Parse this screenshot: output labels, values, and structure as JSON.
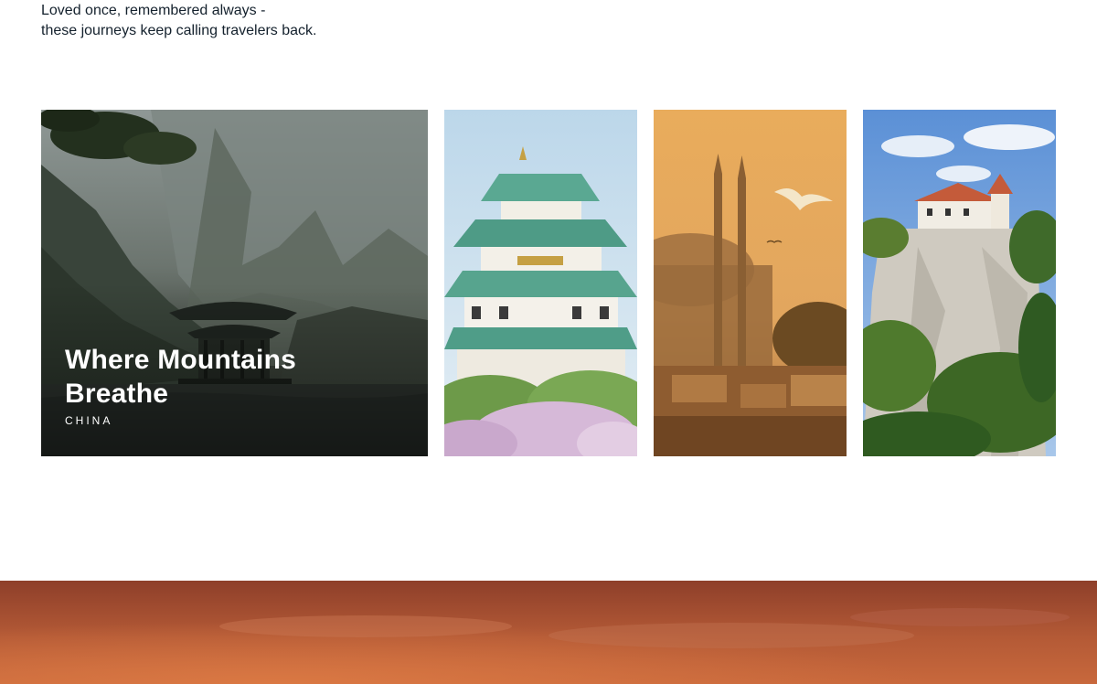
{
  "intro": {
    "line1": "Loved once, remembered always -",
    "line2": "these journeys keep calling travelers back."
  },
  "gallery": {
    "feature": {
      "title": "Where Mountains Breathe",
      "country": "CHINA"
    }
  },
  "colors": {
    "text_dark": "#14212d",
    "caption_white": "#ffffff",
    "banner_orange": "#b75a35"
  }
}
